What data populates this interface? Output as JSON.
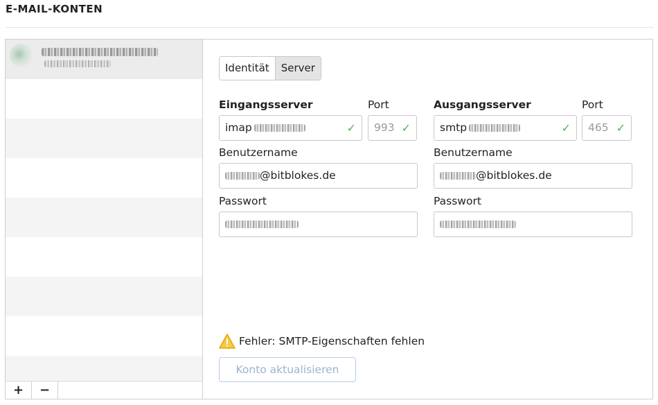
{
  "page": {
    "title": "E-MAIL-KONTEN"
  },
  "sidebar": {
    "toolbar": {
      "add_label": "+",
      "remove_label": "−"
    }
  },
  "tabs": [
    {
      "label": "Identität",
      "active": false
    },
    {
      "label": "Server",
      "active": true
    }
  ],
  "incoming": {
    "server_label": "Eingangsserver",
    "server_value_prefix": "imap",
    "port_label": "Port",
    "port_value": "993",
    "username_label": "Benutzername",
    "username_domain": "@bitblokes.de",
    "password_label": "Passwort"
  },
  "outgoing": {
    "server_label": "Ausgangsserver",
    "server_value_prefix": "smtp",
    "port_label": "Port",
    "port_value": "465",
    "username_label": "Benutzername",
    "username_domain": "@bitblokes.de",
    "password_label": "Passwort"
  },
  "status": {
    "error_text": "Fehler: SMTP-Eigenschaften fehlen",
    "check_mark": "✓"
  },
  "actions": {
    "update_label": "Konto aktualisieren"
  },
  "colors": {
    "valid": "#52b152",
    "warning": "#f2b400",
    "disabled_button": "#9db2cf"
  }
}
